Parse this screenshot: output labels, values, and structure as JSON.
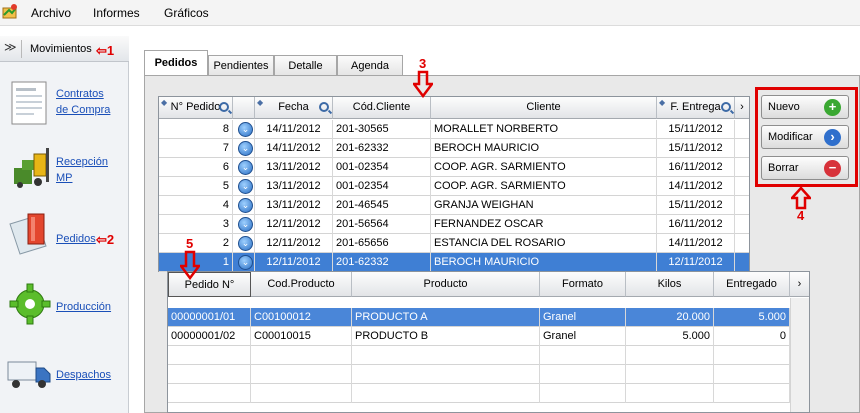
{
  "menu": [
    "Archivo",
    "Informes",
    "Gráficos"
  ],
  "sidebar": {
    "header": "Movimientos",
    "items": [
      {
        "label1": "Contratos",
        "label2": "de Compra"
      },
      {
        "label1": "Recepción",
        "label2": "MP"
      },
      {
        "label1": "Pedidos",
        "label2": ""
      },
      {
        "label1": "Producción",
        "label2": ""
      },
      {
        "label1": "Despachos",
        "label2": ""
      }
    ]
  },
  "tabs": [
    "Pedidos",
    "Pendientes",
    "Detalle",
    "Agenda"
  ],
  "orders": {
    "columns": [
      "N° Pedido",
      "",
      "Fecha",
      "Cód.Cliente",
      "Cliente",
      "F. Entrega"
    ],
    "rows": [
      {
        "num": "8",
        "fecha": "14/11/2012",
        "cod": "201-30565",
        "cliente": "MORALLET NORBERTO",
        "entrega": "15/11/2012"
      },
      {
        "num": "7",
        "fecha": "14/11/2012",
        "cod": "201-62332",
        "cliente": "BEROCH MAURICIO",
        "entrega": "15/11/2012"
      },
      {
        "num": "6",
        "fecha": "13/11/2012",
        "cod": "001-02354",
        "cliente": "COOP. AGR. SARMIENTO",
        "entrega": "16/11/2012"
      },
      {
        "num": "5",
        "fecha": "13/11/2012",
        "cod": "001-02354",
        "cliente": "COOP. AGR. SARMIENTO",
        "entrega": "14/11/2012"
      },
      {
        "num": "4",
        "fecha": "13/11/2012",
        "cod": "201-46545",
        "cliente": "GRANJA WEIGHAN",
        "entrega": "15/11/2012"
      },
      {
        "num": "3",
        "fecha": "12/11/2012",
        "cod": "201-56564",
        "cliente": "FERNANDEZ OSCAR",
        "entrega": "16/11/2012"
      },
      {
        "num": "2",
        "fecha": "12/11/2012",
        "cod": "201-65656",
        "cliente": "ESTANCIA DEL ROSARIO",
        "entrega": "14/11/2012"
      },
      {
        "num": "1",
        "fecha": "12/11/2012",
        "cod": "201-62332",
        "cliente": "BEROCH MAURICIO",
        "entrega": "12/11/2012"
      }
    ]
  },
  "detail": {
    "columns": [
      "Pedido N°",
      "Cod.Producto",
      "Producto",
      "Formato",
      "Kilos",
      "Entregado"
    ],
    "rows": [
      {
        "pedido": "00000001/01",
        "cod": "C00100012",
        "producto": "PRODUCTO A",
        "formato": "Granel",
        "kilos": "20.000",
        "entregado": "5.000"
      },
      {
        "pedido": "00000001/02",
        "cod": "C00010015",
        "producto": "PRODUCTO B",
        "formato": "Granel",
        "kilos": "5.000",
        "entregado": "0"
      }
    ]
  },
  "buttons": {
    "nuevo": "Nuevo",
    "modificar": "Modificar",
    "borrar": "Borrar"
  },
  "markers": [
    "1",
    "2",
    "3",
    "4",
    "5"
  ],
  "colors": {
    "accent": "#e00000",
    "selection": "#3f7fd4",
    "link": "#1a4fb8"
  }
}
